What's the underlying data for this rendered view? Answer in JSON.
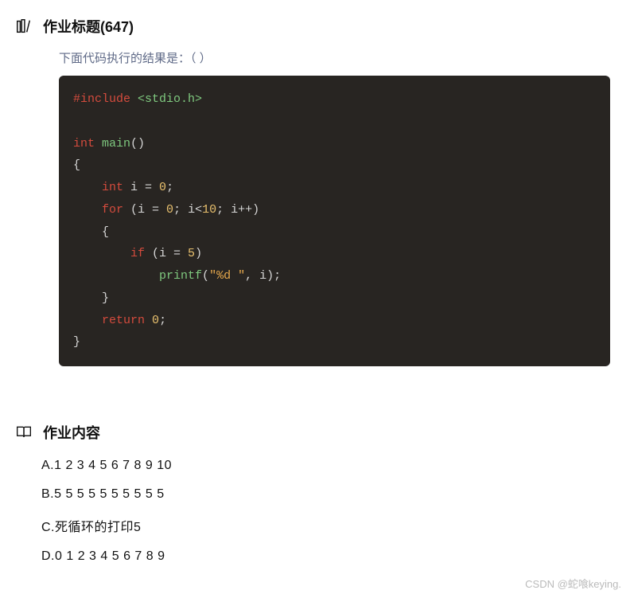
{
  "header1": {
    "icon": "books-icon",
    "title": "作业标题(647)"
  },
  "question": {
    "text": "下面代码执行的结果是：（        ）"
  },
  "code": {
    "l1_dir": "#include",
    "l1_header": "<stdio.h>",
    "l3_type": "int",
    "l3_func": "main",
    "l3_paren": "()",
    "l4_brace": "{",
    "l5_indent": "    ",
    "l5_type": "int",
    "l5_rest_a": " i = ",
    "l5_num": "0",
    "l5_semi": ";",
    "l6_indent": "    ",
    "l6_for": "for",
    "l6_a": " (i = ",
    "l6_n1": "0",
    "l6_b": "; i<",
    "l6_n2": "10",
    "l6_c": "; i++)",
    "l7_indent": "    ",
    "l7_brace": "{",
    "l8_indent": "        ",
    "l8_if": "if",
    "l8_a": " (i = ",
    "l8_n": "5",
    "l8_b": ")",
    "l9_indent": "            ",
    "l9_call": "printf",
    "l9_a": "(",
    "l9_str": "\"%d \"",
    "l9_b": ", i);",
    "l10_indent": "    ",
    "l10_brace": "}",
    "l11_indent": "    ",
    "l11_ret": "return",
    "l11_sp": " ",
    "l11_n": "0",
    "l11_semi": ";",
    "l12_brace": "}"
  },
  "header2": {
    "icon": "book-open-icon",
    "title": "作业内容"
  },
  "options": [
    "A.1 2 3 4 5 6 7 8 9 10",
    "B.5 5 5 5 5 5 5 5 5 5",
    "C.死循环的打印5",
    "D.0 1 2 3 4 5 6 7 8 9"
  ],
  "watermark": "CSDN @蛇喰keying."
}
